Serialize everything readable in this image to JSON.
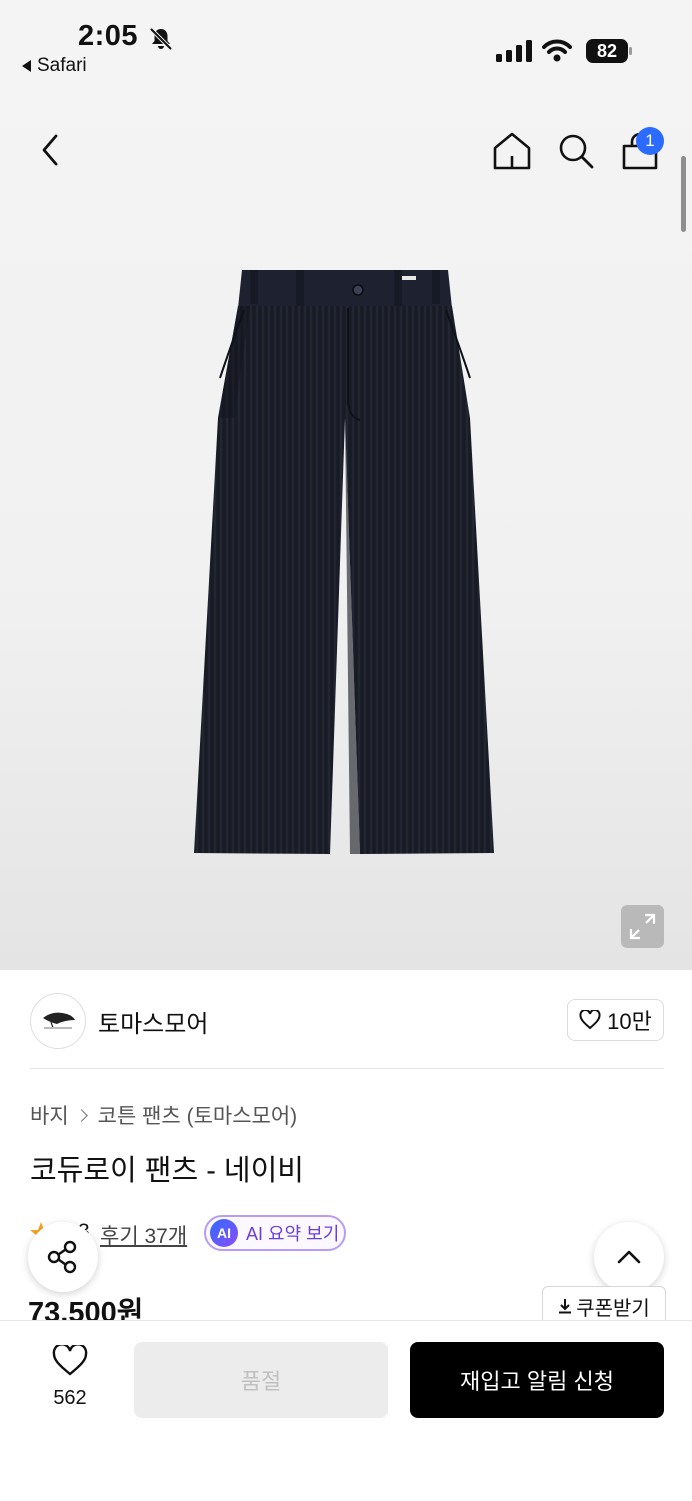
{
  "status_bar": {
    "time": "2:05",
    "back_app": "Safari",
    "battery": "82"
  },
  "nav": {
    "cart_badge": "1"
  },
  "brand": {
    "name": "토마스모어",
    "logo_text": "THOMAS MORE",
    "likes": "10만"
  },
  "breadcrumb": {
    "category": "바지",
    "subcategory": "코튼 팬츠 (토마스모어)"
  },
  "product": {
    "title": "코듀로이 팬츠 - 네이비",
    "rating": "3",
    "reviews": "후기 37개",
    "ai_badge": "AI",
    "ai_summary": "AI 요약 보기",
    "price": "73,500원",
    "coupon": "쿠폰받기"
  },
  "bottom_bar": {
    "wish_count": "562",
    "soldout_label": "품절",
    "restock_label": "재입고 알림 신청"
  },
  "colors": {
    "badge_blue": "#2c6bff",
    "ai_purple": "#6a3fd8",
    "pants_navy": "#1b1e29"
  }
}
